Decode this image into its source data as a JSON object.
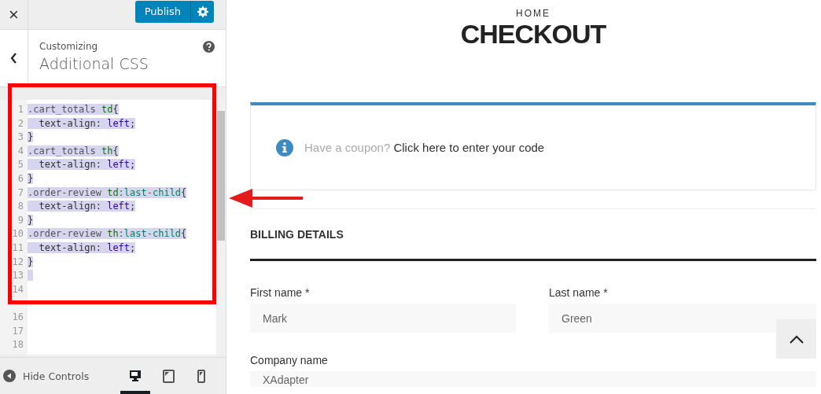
{
  "sidebar": {
    "close": "×",
    "publish": "Publish",
    "section_label": "Customizing",
    "section_title": "Additional CSS",
    "code_lines": [
      {
        "number": "1",
        "selected": true,
        "tokens": [
          {
            "kind": "selector",
            "text": ".cart_totals "
          },
          {
            "kind": "tag",
            "text": "td"
          },
          {
            "kind": "plain",
            "text": "{"
          }
        ]
      },
      {
        "number": "2",
        "selected": true,
        "tokens": [
          {
            "kind": "plain",
            "text": "  text-align: "
          },
          {
            "kind": "value",
            "text": "left"
          },
          {
            "kind": "plain",
            "text": ";"
          }
        ]
      },
      {
        "number": "3",
        "selected": true,
        "tokens": [
          {
            "kind": "plain",
            "text": "}"
          }
        ]
      },
      {
        "number": "4",
        "selected": true,
        "tokens": [
          {
            "kind": "selector",
            "text": ".cart_totals "
          },
          {
            "kind": "tag",
            "text": "th"
          },
          {
            "kind": "plain",
            "text": "{"
          }
        ]
      },
      {
        "number": "5",
        "selected": true,
        "tokens": [
          {
            "kind": "plain",
            "text": "  text-align: "
          },
          {
            "kind": "value",
            "text": "left"
          },
          {
            "kind": "plain",
            "text": ";"
          }
        ]
      },
      {
        "number": "6",
        "selected": true,
        "tokens": [
          {
            "kind": "plain",
            "text": "}"
          }
        ]
      },
      {
        "number": "7",
        "selected": true,
        "tokens": [
          {
            "kind": "selector",
            "text": ".order-review "
          },
          {
            "kind": "tag",
            "text": "td"
          },
          {
            "kind": "pseudo",
            "text": ":last-child"
          },
          {
            "kind": "plain",
            "text": "{"
          }
        ]
      },
      {
        "number": "8",
        "selected": true,
        "tokens": [
          {
            "kind": "plain",
            "text": "  text-align: "
          },
          {
            "kind": "value",
            "text": "left"
          },
          {
            "kind": "plain",
            "text": ";"
          }
        ]
      },
      {
        "number": "9",
        "selected": true,
        "tokens": [
          {
            "kind": "plain",
            "text": "}"
          }
        ]
      },
      {
        "number": "10",
        "selected": true,
        "tokens": [
          {
            "kind": "selector",
            "text": ".order-review "
          },
          {
            "kind": "tag",
            "text": "th"
          },
          {
            "kind": "pseudo",
            "text": ":last-child"
          },
          {
            "kind": "plain",
            "text": "{"
          }
        ]
      },
      {
        "number": "11",
        "selected": true,
        "tokens": [
          {
            "kind": "plain",
            "text": "  text-align: "
          },
          {
            "kind": "value",
            "text": "left"
          },
          {
            "kind": "plain",
            "text": ";"
          }
        ]
      },
      {
        "number": "12",
        "selected": true,
        "tokens": [
          {
            "kind": "plain",
            "text": "}"
          }
        ]
      },
      {
        "number": "13",
        "selected": true
      },
      {
        "number": "14",
        "selected": false
      },
      {
        "selected": false
      },
      {
        "number": "16",
        "selected": false
      },
      {
        "number": "17",
        "selected": false
      },
      {
        "number": "18",
        "selected": false
      }
    ],
    "hide_controls": "Hide Controls",
    "devices": [
      {
        "kind": "desktop",
        "selected": true
      },
      {
        "kind": "tablet",
        "selected": false
      },
      {
        "kind": "mobile",
        "selected": false
      }
    ]
  },
  "preview": {
    "breadcrumb": "HOME",
    "title": "CHECKOUT",
    "coupon": {
      "prompt": "Have a coupon?",
      "link": "Click here to enter your code"
    },
    "billing_heading": "BILLING DETAILS",
    "fields": [
      {
        "label": "First name *",
        "value": "Mark"
      },
      {
        "label": "Last name *",
        "value": "Green"
      },
      {
        "label": "Company name",
        "value": "XAdapter"
      }
    ]
  }
}
